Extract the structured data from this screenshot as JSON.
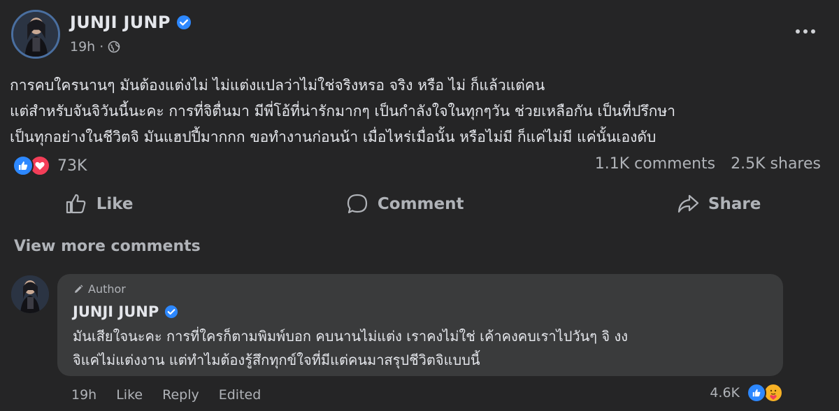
{
  "post": {
    "author": "JUNJI JUNP",
    "time": "19h",
    "time_separator": "·",
    "text_lines": [
      "การคบใครนานๆ มันต้องแต่งไม่ ไม่แต่งแปลว่าไม่ใช่จริงหรอ จริง หรือ ไม่ ก็แล้วแต่คน",
      "แต่สำหรับจันจิวันนี้นะคะ การที่จิตื่นมา มีพี่โอ้ที่น่ารักมากๆ เป็นกำลังใจในทุกๆวัน ช่วยเหลือกัน เป็นที่ปรึกษา",
      "เป็นทุกอย่างในชีวิตจิ มันแฮปปี้มากกก ขอทำงานก่อนน้า เมื่อไหร่เมื่อนั้น หรือไม่มี ก็แค่ไม่มี แค่นั้นเองดับ"
    ],
    "reaction_count": "73K",
    "comments_count": "1.1K comments",
    "shares_count": "2.5K shares"
  },
  "actions": {
    "like": "Like",
    "comment": "Comment",
    "share": "Share"
  },
  "view_more_comments": "View more comments",
  "comment": {
    "badge": "Author",
    "author": "JUNJI JUNP",
    "text_lines": [
      "มันเสียใจนะคะ การที่ใครก็ตามพิมพ์บอก คบนานไม่แต่ง เราคงไม่ใช่ เค้าคงคบเราไปวันๆ จิ งง",
      "จิแค่ไม่แต่งงาน แต่ทำไมต้องรู้สึกทุกข์ใจที่มีแต่คนมาสรุปชีวิตจิแบบนี้"
    ],
    "time": "19h",
    "like": "Like",
    "reply": "Reply",
    "edited": "Edited",
    "reaction_count": "4.6K"
  },
  "icons": {
    "verified": "verified-badge-icon",
    "globe": "globe-icon",
    "more": "more-options-icon",
    "like_reaction": "thumbs-up-icon",
    "love_reaction": "heart-icon",
    "care_reaction": "care-emoji-icon"
  },
  "colors": {
    "background": "#252526",
    "bubble": "#3a3b3c",
    "verified": "#2d88ff",
    "love": "#f33e58",
    "text_primary": "#e4e6eb",
    "text_secondary": "#b0b3b8"
  }
}
